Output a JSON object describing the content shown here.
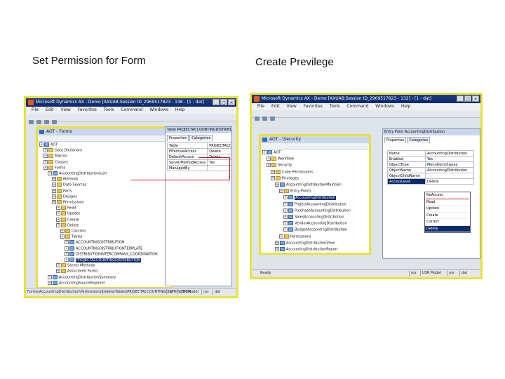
{
  "captions": {
    "left": "Set Permission for Form",
    "right": "Create Previlege"
  },
  "left": {
    "window_title": "Microsoft Dynamics AX - Demo [AXUAB:Session ID_2969517823 - 138 - [1 - dat]",
    "menu": [
      "File",
      "Edit",
      "View",
      "Favorites",
      "Tools",
      "Command",
      "Windows",
      "Help"
    ],
    "aot_title": "AOT - Forms",
    "tree": [
      {
        "t": "AOT",
        "lvl": 0,
        "ic": "blue"
      },
      {
        "t": "Data Dictionary",
        "lvl": 1,
        "ic": "yellow"
      },
      {
        "t": "Macros",
        "lvl": 1,
        "ic": "yellow"
      },
      {
        "t": "Classes",
        "lvl": 1,
        "ic": "yellow"
      },
      {
        "t": "Forms",
        "lvl": 1,
        "ic": "yellow"
      },
      {
        "t": "AccountingDistribution(usr)",
        "lvl": 2,
        "ic": "blue"
      },
      {
        "t": "Methods",
        "lvl": 3,
        "ic": "yellow"
      },
      {
        "t": "Data Sources",
        "lvl": 3,
        "ic": "yellow"
      },
      {
        "t": "Parts",
        "lvl": 3,
        "ic": "yellow"
      },
      {
        "t": "Designs",
        "lvl": 3,
        "ic": "yellow"
      },
      {
        "t": "Permissions",
        "lvl": 3,
        "ic": "yellow"
      },
      {
        "t": "Read",
        "lvl": 4,
        "ic": "yellow"
      },
      {
        "t": "Update",
        "lvl": 4,
        "ic": "yellow"
      },
      {
        "t": "Create",
        "lvl": 4,
        "ic": "yellow"
      },
      {
        "t": "Delete",
        "lvl": 4,
        "ic": "yellow"
      },
      {
        "t": "Controls",
        "lvl": 5,
        "ic": "yellow"
      },
      {
        "t": "Tables",
        "lvl": 5,
        "ic": "yellow"
      },
      {
        "t": "ACCOUNTINGDISTRIBUTION",
        "lvl": 6,
        "ic": "blue"
      },
      {
        "t": "ACCOUNTINGDISTRIBUTIONTEMPLATE",
        "lvl": 6,
        "ic": "blue"
      },
      {
        "t": "DISTRIBUTIONINTERCOMPANY_COORDINATION",
        "lvl": 6,
        "ic": "blue"
      },
      {
        "t": "PROJECTACCOUNTINGDISTRIBUTION",
        "lvl": 6,
        "ic": "blue",
        "sel": true
      },
      {
        "t": "Server Methods",
        "lvl": 4,
        "ic": "yellow"
      },
      {
        "t": "Associated Forms",
        "lvl": 4,
        "ic": "yellow"
      },
      {
        "t": "AccountingDistributionSummary",
        "lvl": 2,
        "ic": "blue"
      },
      {
        "t": "AccountingSourceExplorer",
        "lvl": 2,
        "ic": "blue"
      }
    ],
    "prop_title": "Table PROJECTACCOUNTINGDISTRIBUTION",
    "tabs": [
      "Properties",
      "Categories"
    ],
    "props": [
      [
        "Table",
        "PROJECTACCOUNTINGDISTRIBUTION"
      ],
      [
        "EffectiveAccess",
        "Delete"
      ],
      [
        "DefaultAccess",
        "Delete"
      ],
      [
        "ServerMethodAccess",
        "Yes"
      ],
      [
        "ManagedBy",
        ""
      ]
    ],
    "status": {
      "path": "Forms\\AccountingDistribution\\Permissions\\Delete\\Tables\\PROJECTACCOUNTINGDISTRIBUTION",
      "c1": "usr",
      "c2": "USR Model",
      "c3": "usr",
      "c4": "dat"
    }
  },
  "right": {
    "window_title": "Microsoft Dynamics AX - Demo [AXUAB:Session ID_2969517823 - 132] - [1 - dat]",
    "menu": [
      "File",
      "Edit",
      "View",
      "Favorites",
      "Tools",
      "Command",
      "Windows",
      "Help"
    ],
    "aot_title": "AOT - \\Security",
    "tree": [
      {
        "t": "AOT",
        "lvl": 0,
        "ic": "blue"
      },
      {
        "t": "Workflow",
        "lvl": 1,
        "ic": "yellow"
      },
      {
        "t": "Security",
        "lvl": 1,
        "ic": "yellow"
      },
      {
        "t": "Code Permissions",
        "lvl": 2,
        "ic": "yellow"
      },
      {
        "t": "Privileges",
        "lvl": 2,
        "ic": "yellow"
      },
      {
        "t": "AccountingDistributionMaintain",
        "lvl": 3,
        "ic": "blue"
      },
      {
        "t": "Entry Points",
        "lvl": 4,
        "ic": "yellow"
      },
      {
        "t": "AccountingDistribution",
        "lvl": 5,
        "ic": "blue",
        "sel": true
      },
      {
        "t": "ProjectAccountingDistribution",
        "lvl": 5,
        "ic": "blue"
      },
      {
        "t": "PurchaseAccountingDistribution",
        "lvl": 5,
        "ic": "blue"
      },
      {
        "t": "SalesAccountingDistribution",
        "lvl": 5,
        "ic": "blue"
      },
      {
        "t": "VendorAccountingDistribution",
        "lvl": 5,
        "ic": "blue"
      },
      {
        "t": "BudgetAccountingDistribution",
        "lvl": 5,
        "ic": "blue"
      },
      {
        "t": "Permissions",
        "lvl": 4,
        "ic": "yellow"
      },
      {
        "t": "AccountingDistributionView",
        "lvl": 3,
        "ic": "blue"
      },
      {
        "t": "AccountingDistributionReport",
        "lvl": 3,
        "ic": "blue"
      }
    ],
    "prop_title": "Entry Point AccountingDistribution",
    "tabs": [
      "Properties",
      "Categories"
    ],
    "props": [
      [
        "Name",
        "AccountingDistribution"
      ],
      [
        "Enabled",
        "Yes"
      ],
      [
        "ObjectType",
        "MenuItemDisplay"
      ],
      [
        "ObjectName",
        "AccountingDistribution"
      ],
      [
        "ObjectChildName",
        ""
      ],
      [
        "AccessLevel",
        "Delete"
      ]
    ],
    "dropdown": [
      "NoAccess",
      "Read",
      "Update",
      "Create",
      "Correct",
      "Delete"
    ],
    "dropdown_selected": 5,
    "status": {
      "path": "Ready",
      "c1": "usr",
      "c2": "USR Model",
      "c3": "usr",
      "c4": "dat"
    }
  }
}
